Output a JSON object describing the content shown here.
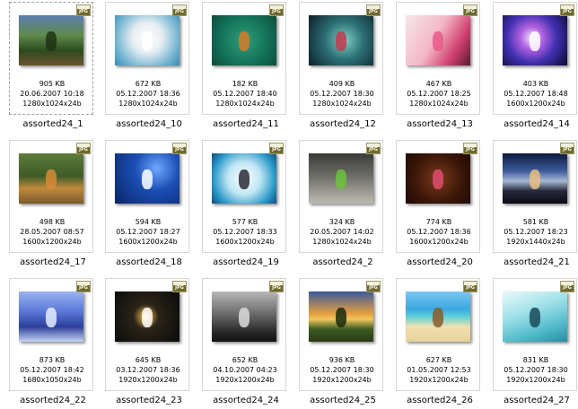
{
  "files": [
    {
      "name": "assorted24_1",
      "size": "905 KB",
      "date": "20.06.2007 10:18",
      "dims": "1280x1024x24b",
      "badge": "JPG",
      "selected": true,
      "thumb": {
        "bg": "linear-gradient(180deg,#5d7fb0 0%,#5e8a4a 40%,#2e4a1e 70%,#6b5330 100%)",
        "fg": "#1d3312"
      }
    },
    {
      "name": "assorted24_10",
      "size": "672 KB",
      "date": "05.12.2007 18:36",
      "dims": "1280x1024x24b",
      "badge": "JPG",
      "thumb": {
        "bg": "radial-gradient(circle at 50% 45%,#ffffff 0%,#e6eef2 35%,#6fb2cf 75%,#3a8bb5 100%)",
        "fg": "#ffffff"
      }
    },
    {
      "name": "assorted24_11",
      "size": "182 KB",
      "date": "05.12.2007 18:40",
      "dims": "1280x1024x24b",
      "badge": "JPG",
      "thumb": {
        "bg": "radial-gradient(circle at 50% 50%,#2e9e7c 0%,#137057 60%,#0b4c3a 100%)",
        "fg": "#d87a2c"
      }
    },
    {
      "name": "assorted24_12",
      "size": "409 KB",
      "date": "05.12.2007 18:30",
      "dims": "1280x1024x24b",
      "badge": "JPG",
      "thumb": {
        "bg": "radial-gradient(circle at 55% 50%,#7fd0c4 0%,#2b6f74 45%,#0e1f2a 100%)",
        "fg": "#c23a4c"
      }
    },
    {
      "name": "assorted24_13",
      "size": "467 KB",
      "date": "05.12.2007 18:25",
      "dims": "1280x1024x24b",
      "badge": "JPG",
      "thumb": {
        "bg": "linear-gradient(120deg,#f7e6ea 0%,#f3b7c6 45%,#d04070 75%,#5a1830 100%)",
        "fg": "#e85a8a"
      }
    },
    {
      "name": "assorted24_14",
      "size": "403 KB",
      "date": "05.12.2007 18:48",
      "dims": "1600x1200x24b",
      "badge": "JPG",
      "thumb": {
        "bg": "radial-gradient(circle at 45% 45%,#f0e8ff 0%,#b060e0 25%,#4030b0 55%,#0c0830 100%)",
        "fg": "#ffffff"
      }
    },
    {
      "name": "assorted24_17",
      "size": "498 KB",
      "date": "28.05.2007 08:57",
      "dims": "1600x1200x24b",
      "badge": "JPG",
      "thumb": {
        "bg": "linear-gradient(180deg,#5f7d3a 0%,#3e5a28 45%,#c08a3c 70%,#7a5a2a 100%)",
        "fg": "#d88a34"
      }
    },
    {
      "name": "assorted24_18",
      "size": "594 KB",
      "date": "05.12.2007 18:27",
      "dims": "1600x1200x24b",
      "badge": "JPG",
      "thumb": {
        "bg": "radial-gradient(circle at 65% 30%,#6fa8ff 0%,#1b4fb4 40%,#0a2468 100%)",
        "fg": "#ffffff"
      }
    },
    {
      "name": "assorted24_19",
      "size": "577 KB",
      "date": "05.12.2007 18:33",
      "dims": "1600x1200x24b",
      "badge": "JPG",
      "thumb": {
        "bg": "radial-gradient(circle at 50% 50%,#ffffff 0%,#bfe6f4 40%,#2a98c8 75%,#0c4c7c 100%)",
        "fg": "#2a2a3a"
      }
    },
    {
      "name": "assorted24_2",
      "size": "324 KB",
      "date": "20.05.2007 14:02",
      "dims": "1280x1024x24b",
      "badge": "JPG",
      "thumb": {
        "bg": "linear-gradient(180deg,#3a3a38 0%,#6e6e68 45%,#9a9890 75%,#bcbab0 100%)",
        "fg": "#6bc23a"
      }
    },
    {
      "name": "assorted24_20",
      "size": "774 KB",
      "date": "05.12.2007 18:36",
      "dims": "1600x1200x24b",
      "badge": "JPG",
      "thumb": {
        "bg": "radial-gradient(circle at 50% 50%,#7a3a1a 0%,#3a1608 60%,#200a04 100%)",
        "fg": "#e04c70"
      }
    },
    {
      "name": "assorted24_21",
      "size": "581 KB",
      "date": "05.12.2007 18:23",
      "dims": "1920x1440x24b",
      "badge": "JPG",
      "thumb": {
        "bg": "linear-gradient(180deg,#0e1a3c 0%,#3c5a9a 35%,#a8b8d4 55%,#24283a 75%,#0a0c14 100%)",
        "fg": "#e8c080"
      }
    },
    {
      "name": "assorted24_22",
      "size": "873 KB",
      "date": "05.12.2007 18:42",
      "dims": "1680x1050x24b",
      "badge": "JPG",
      "thumb": {
        "bg": "linear-gradient(180deg,#9ab4ee 0%,#5a78d8 40%,#2c3e9a 70%,#c4d2f4 100%)",
        "fg": "#e8eeff"
      }
    },
    {
      "name": "assorted24_23",
      "size": "645 KB",
      "date": "03.12.2007 18:36",
      "dims": "1920x1200x24b",
      "badge": "JPG",
      "thumb": {
        "bg": "radial-gradient(circle at 48% 50%,#fff6d0 0%,#c8a040 8%,#2a2418 30%,#0a0a0a 100%)",
        "fg": "#ffffff"
      }
    },
    {
      "name": "assorted24_24",
      "size": "652 KB",
      "date": "04.10.2007 04:23",
      "dims": "1920x1200x24b",
      "badge": "JPG",
      "thumb": {
        "bg": "linear-gradient(180deg,#b8b8b8 0%,#6a6a6a 45%,#2a2a2a 80%,#111111 100%)",
        "fg": "#dcdcdc"
      }
    },
    {
      "name": "assorted24_25",
      "size": "936 KB",
      "date": "05.12.2007 18:30",
      "dims": "1920x1200x24b",
      "badge": "JPG",
      "thumb": {
        "bg": "linear-gradient(180deg,#3a5a9a 0%,#e8a040 45%,#f0c860 55%,#3a5a20 75%,#2a3a14 100%)",
        "fg": "#1a2a0a"
      }
    },
    {
      "name": "assorted24_26",
      "size": "627 KB",
      "date": "01.05.2007 12:53",
      "dims": "1920x1200x24b",
      "badge": "JPG",
      "thumb": {
        "bg": "linear-gradient(180deg,#7ac8f0 0%,#3aa8e0 35%,#5cd0d8 50%,#f0e0b0 70%,#e8d29a 100%)",
        "fg": "#8a5a2a"
      }
    },
    {
      "name": "assorted24_27",
      "size": "831 KB",
      "date": "05.12.2007 18:30",
      "dims": "1920x1200x24b",
      "badge": "JPG",
      "thumb": {
        "bg": "linear-gradient(160deg,#e8fafa 0%,#9ee0e8 40%,#4cb8c8 75%,#2a8aa0 100%)",
        "fg": "#1a4a5a"
      }
    }
  ]
}
